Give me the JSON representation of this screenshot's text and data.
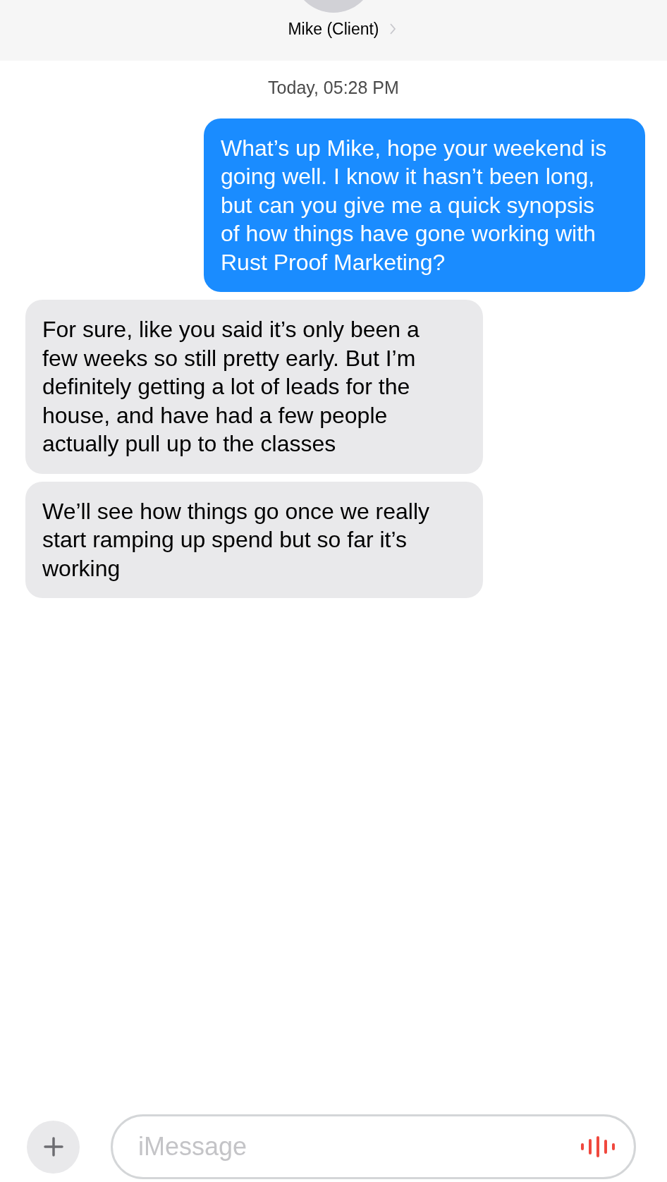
{
  "header": {
    "contact_name": "Mike (Client)"
  },
  "timestamp": "Today, 05:28 PM",
  "messages": [
    {
      "kind": "sent",
      "text": "What’s up Mike, hope your weekend is going well. I know it hasn’t been long, but can you give me a quick synopsis of how things have gone working with Rust Proof Marketing?"
    },
    {
      "kind": "received",
      "text": "For sure, like you said it’s only been a few weeks so still pretty early. But I’m definitely getting a lot of leads for the house, and have had a few people actually pull up to the classes"
    },
    {
      "kind": "received",
      "text": "We’ll see how things go once we really start ramping up spend but so far it’s working"
    }
  ],
  "composer": {
    "placeholder": "iMessage"
  }
}
